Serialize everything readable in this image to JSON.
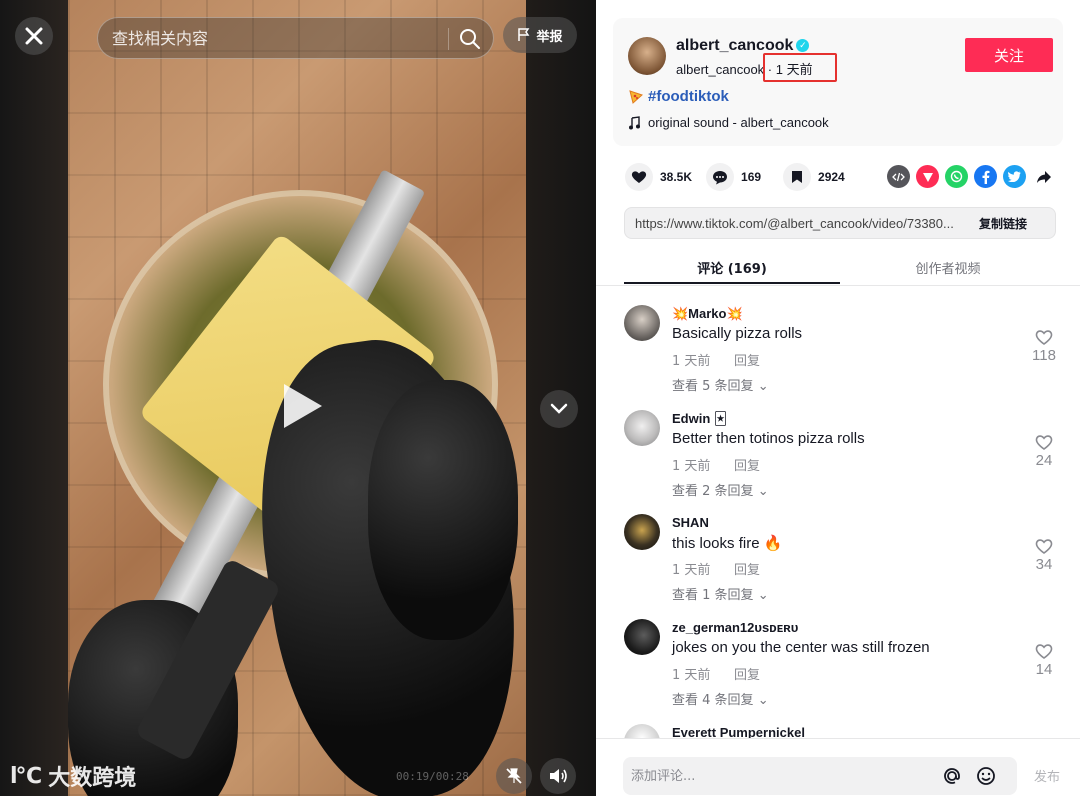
{
  "search": {
    "placeholder": "查找相关内容"
  },
  "top_bar": {
    "report_label": "举报"
  },
  "player": {
    "time": "00:19/00:28"
  },
  "watermark": {
    "logo": "l℃",
    "text": "大数跨境"
  },
  "author": {
    "display_name": "albert_cancook",
    "username": "albert_cancook",
    "posted": "1 天前",
    "follow_label": "关注",
    "hashtag": "#foodtiktok",
    "sound": "original sound - albert_cancook"
  },
  "stats": {
    "likes": "38.5K",
    "comments": "169",
    "saves": "2924"
  },
  "share_icons": [
    "embed-icon",
    "telegram-icon",
    "whatsapp-icon",
    "facebook-icon",
    "twitter-icon",
    "share-arrow-icon"
  ],
  "link": {
    "url": "https://www.tiktok.com/@albert_cancook/video/73380...",
    "copy_label": "复制链接"
  },
  "tabs": [
    {
      "label": "评论 (169)",
      "active": true
    },
    {
      "label": "创作者视频",
      "active": false
    }
  ],
  "comments": [
    {
      "user": "💥Marko💥",
      "text": "Basically pizza rolls",
      "time": "1 天前",
      "reply": "回复",
      "view_replies": "查看 5 条回复",
      "likes": "118"
    },
    {
      "user": "Edwin 🃏",
      "text": "Better then totinos pizza rolls",
      "time": "1 天前",
      "reply": "回复",
      "view_replies": "查看 2 条回复",
      "likes": "24"
    },
    {
      "user": "SHAN",
      "text": "this looks fire 🔥",
      "time": "1 天前",
      "reply": "回复",
      "view_replies": "查看 1 条回复",
      "likes": "34"
    },
    {
      "user": "ze_german12ᴜsᴅᴇʀᴜ",
      "text": "jokes on you the center was still frozen",
      "time": "1 天前",
      "reply": "回复",
      "view_replies": "查看 4 条回复",
      "likes": "14"
    },
    {
      "user": "Everett Pumpernickel"
    }
  ],
  "comment_input": {
    "placeholder": "添加评论...",
    "post_label": "发布"
  },
  "colors": {
    "accent": "#fe2c55",
    "hashtag": "#2b5db9",
    "highlight_box": "#e5312e"
  }
}
